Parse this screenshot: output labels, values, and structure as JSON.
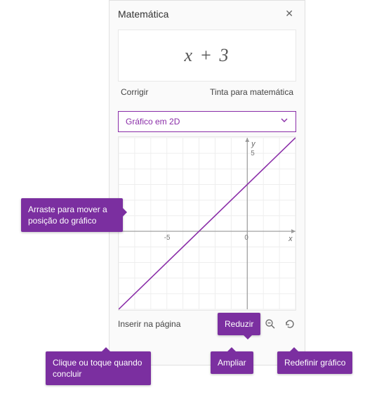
{
  "pane": {
    "title": "Matemática",
    "expression": "x + 3",
    "links": {
      "fix": "Corrigir",
      "ink": "Tinta para matemática"
    },
    "select_label": "Gráfico em 2D",
    "insert_label": "Inserir na página"
  },
  "callouts": {
    "drag": "Arraste para mover a posição do gráfico",
    "reduce": "Reduzir",
    "insert": "Clique ou toque quando concluir",
    "zoomin": "Ampliar",
    "reset": "Redefinir gráfico"
  },
  "chart_data": {
    "type": "line",
    "title": "",
    "xlabel": "x",
    "ylabel": "y",
    "xlim": [
      -8,
      3
    ],
    "ylim": [
      -5,
      6
    ],
    "x_ticks": [
      -5,
      0
    ],
    "y_ticks": [
      0,
      5
    ],
    "series": [
      {
        "name": "x + 3",
        "color": "#8a2da8",
        "points": [
          {
            "x": -8,
            "y": -5
          },
          {
            "x": 3,
            "y": 6
          }
        ]
      }
    ]
  }
}
